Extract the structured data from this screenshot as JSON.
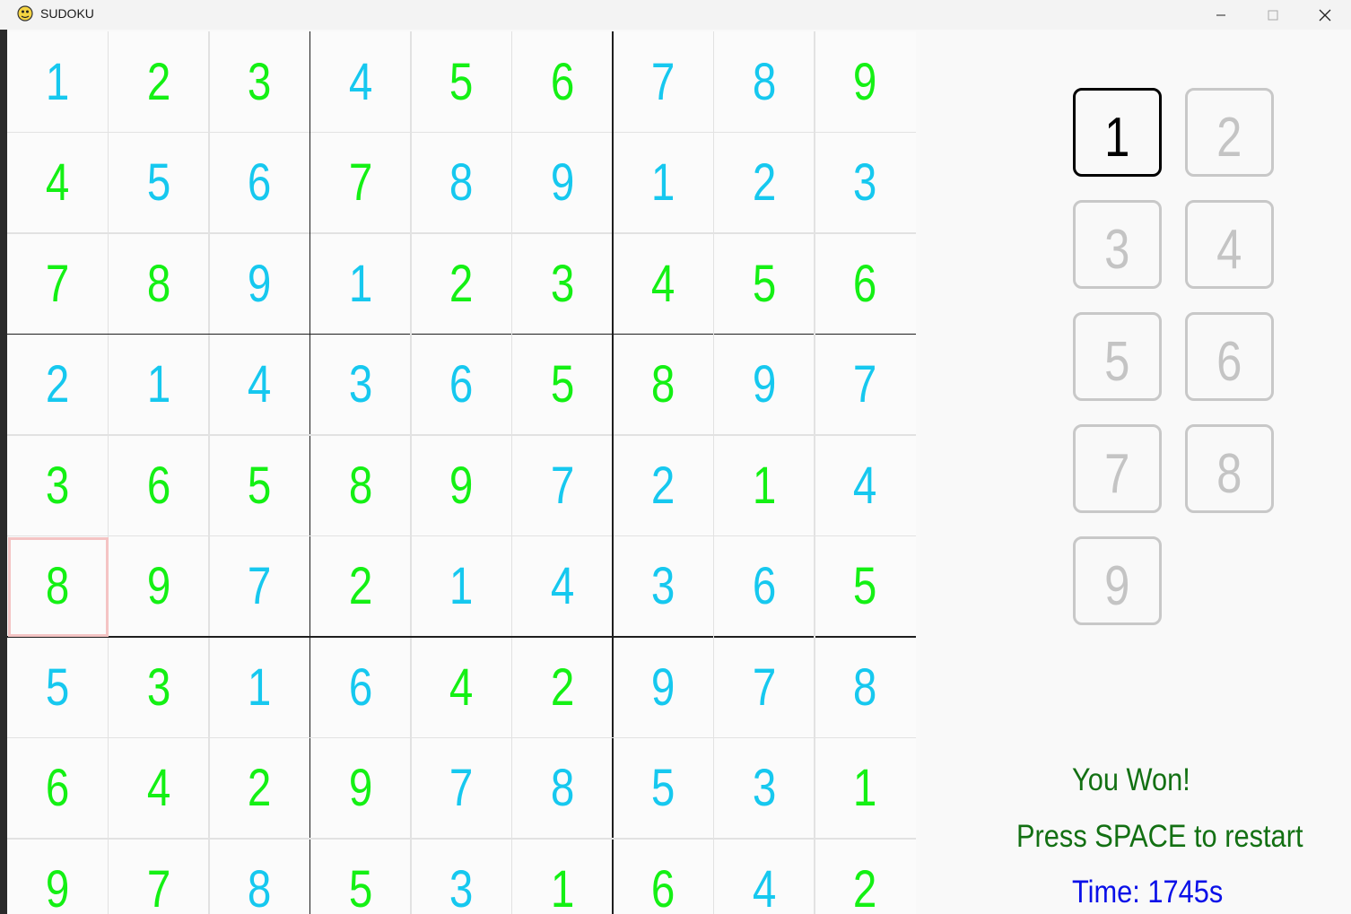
{
  "window": {
    "title": "SUDOKU",
    "icon": "pygame-snake-icon",
    "controls": [
      "minimize-icon",
      "maximize-icon",
      "close-icon"
    ]
  },
  "colors": {
    "given": "#14f014",
    "entered": "#16c8ef",
    "selected_border": "#f4c4c4",
    "win_text": "#137013",
    "time_text": "#0a10e8",
    "pad_inactive": "#c4c4c4",
    "pad_active": "#000000"
  },
  "board": {
    "selected": {
      "row": 5,
      "col": 0
    },
    "rows": [
      [
        "1",
        "2",
        "3",
        "4",
        "5",
        "6",
        "7",
        "8",
        "9"
      ],
      [
        "4",
        "5",
        "6",
        "7",
        "8",
        "9",
        "1",
        "2",
        "3"
      ],
      [
        "7",
        "8",
        "9",
        "1",
        "2",
        "3",
        "4",
        "5",
        "6"
      ],
      [
        "2",
        "1",
        "4",
        "3",
        "6",
        "5",
        "8",
        "9",
        "7"
      ],
      [
        "3",
        "6",
        "5",
        "8",
        "9",
        "7",
        "2",
        "1",
        "4"
      ],
      [
        "8",
        "9",
        "7",
        "2",
        "1",
        "4",
        "3",
        "6",
        "5"
      ],
      [
        "5",
        "3",
        "1",
        "6",
        "4",
        "2",
        "9",
        "7",
        "8"
      ],
      [
        "6",
        "4",
        "2",
        "9",
        "7",
        "8",
        "5",
        "3",
        "1"
      ],
      [
        "9",
        "7",
        "8",
        "5",
        "3",
        "1",
        "6",
        "4",
        "2"
      ]
    ],
    "kinds": [
      [
        "e",
        "g",
        "g",
        "e",
        "g",
        "g",
        "e",
        "e",
        "g"
      ],
      [
        "g",
        "e",
        "e",
        "g",
        "e",
        "e",
        "e",
        "e",
        "e"
      ],
      [
        "g",
        "g",
        "e",
        "e",
        "g",
        "g",
        "g",
        "g",
        "g"
      ],
      [
        "e",
        "e",
        "e",
        "e",
        "e",
        "g",
        "g",
        "e",
        "e"
      ],
      [
        "g",
        "g",
        "g",
        "g",
        "g",
        "e",
        "e",
        "g",
        "e"
      ],
      [
        "g",
        "g",
        "e",
        "g",
        "e",
        "e",
        "e",
        "e",
        "g"
      ],
      [
        "e",
        "g",
        "e",
        "e",
        "g",
        "g",
        "e",
        "e",
        "e"
      ],
      [
        "g",
        "g",
        "g",
        "g",
        "e",
        "e",
        "e",
        "e",
        "g"
      ],
      [
        "g",
        "g",
        "e",
        "g",
        "e",
        "g",
        "g",
        "e",
        "g"
      ]
    ]
  },
  "number_pad": {
    "active": "1",
    "buttons": [
      "1",
      "2",
      "3",
      "4",
      "5",
      "6",
      "7",
      "8",
      "9"
    ]
  },
  "status": {
    "won": "You Won!",
    "restart_hint": "Press SPACE to restart",
    "time": "Time: 1745s"
  }
}
